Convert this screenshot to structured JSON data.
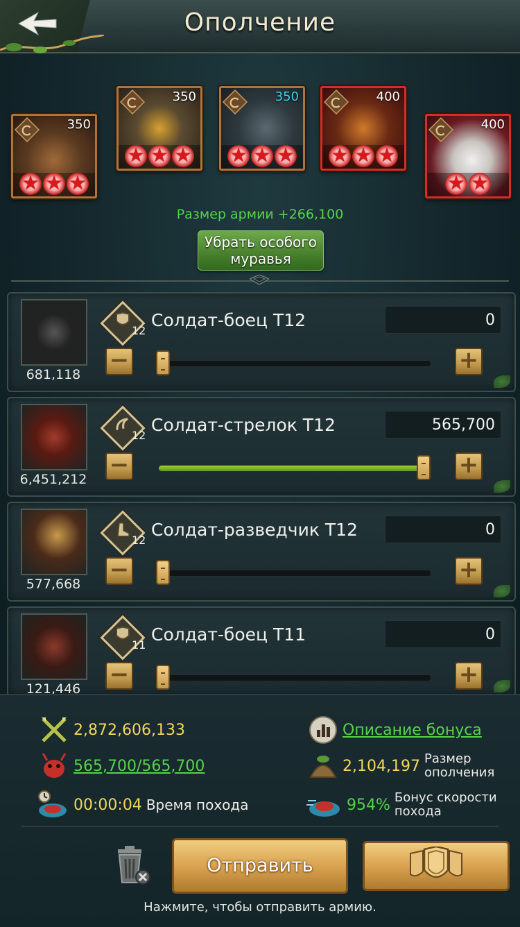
{
  "header": {
    "title": "Ополчение"
  },
  "specials": [
    {
      "level": "350",
      "stars": 3,
      "frame": "bronze",
      "level_color": "#ffffff"
    },
    {
      "level": "350",
      "stars": 3,
      "frame": "bronze",
      "level_color": "#ffffff"
    },
    {
      "level": "350",
      "stars": 3,
      "frame": "bronze",
      "level_color": "#35d7f0"
    },
    {
      "level": "400",
      "stars": 3,
      "frame": "red",
      "level_color": "#ffffff"
    },
    {
      "level": "400",
      "stars": 2,
      "frame": "red",
      "level_color": "#ffffff"
    }
  ],
  "army_size_bonus": "Размер армии +266,100",
  "remove_special_label": "Убрать особого муравья",
  "troops": [
    {
      "name": "Солдат-боец T12",
      "tier": "12",
      "count": "681,118",
      "quantity": "0",
      "fill_fraction": 0.0,
      "icon": "shield-icon"
    },
    {
      "name": "Солдат-стрелок T12",
      "tier": "12",
      "count": "6,451,212",
      "quantity": "565,700",
      "fill_fraction": 1.0,
      "icon": "claw-icon"
    },
    {
      "name": "Солдат-разведчик T12",
      "tier": "12",
      "count": "577,668",
      "quantity": "0",
      "fill_fraction": 0.0,
      "icon": "boot-icon"
    },
    {
      "name": "Солдат-боец T11",
      "tier": "11",
      "count": "121,446",
      "quantity": "0",
      "fill_fraction": 0.0,
      "icon": "shield-icon"
    }
  ],
  "stats": {
    "power": "2,872,606,133",
    "bonus_desc": "Описание бонуса",
    "troops_ratio": "565,700/565,700",
    "militia_size_value": "2,104,197",
    "militia_size_label": "Размер ополчения",
    "march_time_value": "00:00:04",
    "march_time_label": "Время похода",
    "speed_bonus_value": "954%",
    "speed_bonus_label": "Бонус скорости похода"
  },
  "actions": {
    "send_label": "Отправить",
    "hint": "Нажмите, чтобы отправить армию."
  },
  "colors": {
    "accent_green": "#56d34a",
    "gold": "#f3d65a",
    "button_gold": "#d9a351"
  }
}
